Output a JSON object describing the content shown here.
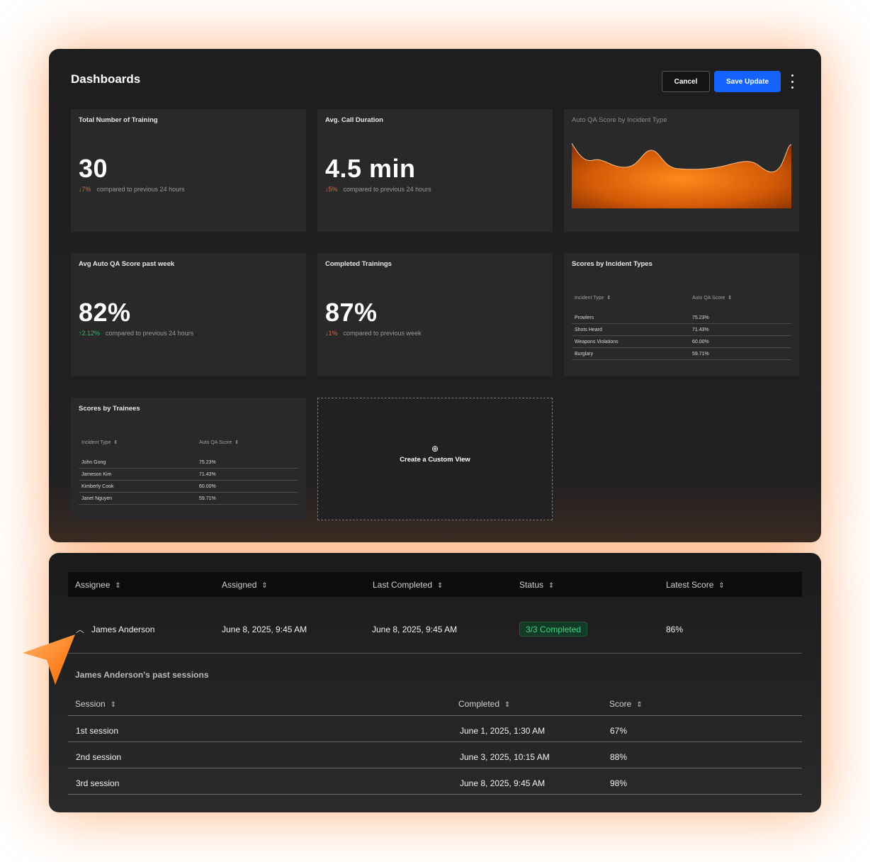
{
  "header": {
    "title": "Dashboards",
    "cancel_label": "Cancel",
    "save_label": "Save Update"
  },
  "cards": {
    "training": {
      "title": "Total Number of Training",
      "value": "30",
      "delta": "↓7%",
      "compare": "compared to previous 24 hours"
    },
    "duration": {
      "title": "Avg. Call Duration",
      "value": "4.5 min",
      "delta": "↓5%",
      "compare": "compared to previous 24 hours"
    },
    "qa_chart": {
      "title": "Auto QA Score by Incident Type"
    },
    "avg_qa": {
      "title": "Avg Auto QA Score past week",
      "value": "82%",
      "delta": "↑2.12%",
      "compare": "compared to previous 24 hours"
    },
    "completed": {
      "title": "Completed Trainings",
      "value": "87%",
      "delta": "↓1%",
      "compare": "compared to previous week"
    },
    "incident_types": {
      "title": "Scores by Incident Types",
      "col1": "Incident Type",
      "col2": "Auto QA Score",
      "rows": [
        {
          "name": "Prowlers",
          "score": "75.23%"
        },
        {
          "name": "Shots Heard",
          "score": "71.43%"
        },
        {
          "name": "Weapons Violations",
          "score": "60.00%"
        },
        {
          "name": "Burglary",
          "score": "59.71%"
        }
      ]
    },
    "trainees": {
      "title": "Scores by Trainees",
      "col1": "Incident Type",
      "col2": "Auto QA Score",
      "rows": [
        {
          "name": "John Gong",
          "score": "75.23%"
        },
        {
          "name": "Jameson Kim",
          "score": "71.43%"
        },
        {
          "name": "Kimberly Cook",
          "score": "60.00%"
        },
        {
          "name": "Janet Nguyen",
          "score": "59.71%"
        }
      ]
    },
    "custom": {
      "label": "Create a Custom View"
    }
  },
  "table": {
    "columns": [
      "Assignee",
      "Assigned",
      "Last Completed",
      "Status",
      "Latest Score"
    ],
    "row": {
      "assignee": "James Anderson",
      "assigned": "June 8, 2025, 9:45 AM",
      "last_completed": "June 8, 2025, 9:45 AM",
      "status": "3/3 Completed",
      "latest_score": "86%"
    },
    "past_title": "James Anderson's past sessions",
    "sub_columns": [
      "Session",
      "Completed",
      "Score"
    ],
    "sessions": [
      {
        "session": "1st session",
        "completed": "June 1, 2025, 1:30 AM",
        "score": "67%"
      },
      {
        "session": "2nd session",
        "completed": "June 3, 2025, 10:15 AM",
        "score": "88%"
      },
      {
        "session": "3rd session",
        "completed": "June 8, 2025, 9:45 AM",
        "score": "98%"
      }
    ]
  },
  "colors": {
    "accent_blue": "#1463ff",
    "accent_orange": "#ff7a1a",
    "status_green": "#3fd47e",
    "delta_down": "#e0683a",
    "delta_up": "#35b86a"
  }
}
